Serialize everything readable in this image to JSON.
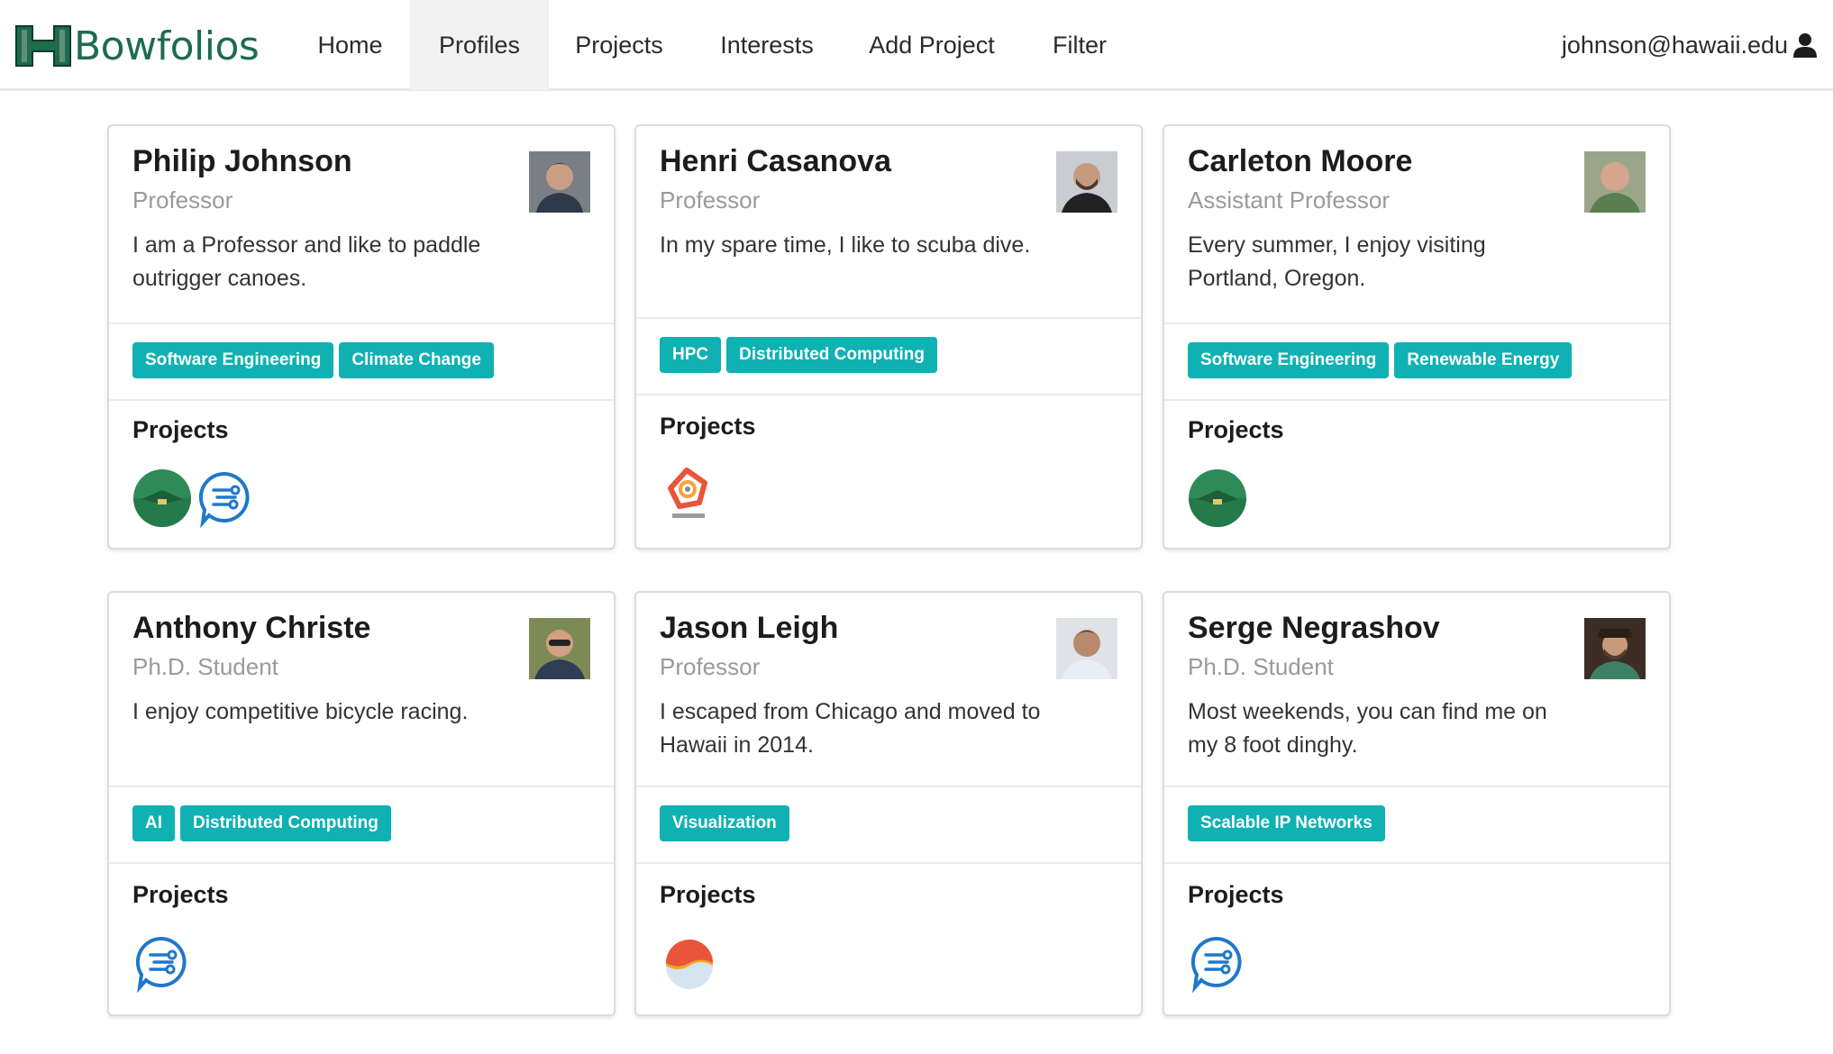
{
  "brand": {
    "name": "Bowfolios"
  },
  "nav": {
    "items": [
      "Home",
      "Profiles",
      "Projects",
      "Interests",
      "Add Project",
      "Filter"
    ],
    "active": "Profiles"
  },
  "user": {
    "email": "johnson@hawaii.edu"
  },
  "colors": {
    "tag": "#0fb1b3",
    "brand": "#1e6b4f"
  },
  "profiles": [
    {
      "name": "Philip Johnson",
      "title": "Professor",
      "bio": "I am a Professor and like to paddle outrigger canoes.",
      "interests": [
        "Software Engineering",
        "Climate Change"
      ],
      "projects_label": "Projects",
      "projects": [
        "green-hat-logo",
        "chat-circuit-logo"
      ]
    },
    {
      "name": "Henri Casanova",
      "title": "Professor",
      "bio": "In my spare time, I like to scuba dive.",
      "interests": [
        "HPC",
        "Distributed Computing"
      ],
      "projects_label": "Projects",
      "projects": [
        "wrench-logo"
      ]
    },
    {
      "name": "Carleton Moore",
      "title": "Assistant Professor",
      "bio": "Every summer, I enjoy visiting Portland, Oregon.",
      "interests": [
        "Software Engineering",
        "Renewable Energy"
      ],
      "projects_label": "Projects",
      "projects": [
        "green-hat-logo"
      ]
    },
    {
      "name": "Anthony Christe",
      "title": "Ph.D. Student",
      "bio": "I enjoy competitive bicycle racing.",
      "interests": [
        "AI",
        "Distributed Computing"
      ],
      "projects_label": "Projects",
      "projects": [
        "chat-circuit-logo"
      ]
    },
    {
      "name": "Jason Leigh",
      "title": "Professor",
      "bio": "I escaped from Chicago and moved to Hawaii in 2014.",
      "interests": [
        "Visualization"
      ],
      "projects_label": "Projects",
      "projects": [
        "wave-sun-logo"
      ]
    },
    {
      "name": "Serge Negrashov",
      "title": "Ph.D. Student",
      "bio": "Most weekends, you can find me on my 8 foot dinghy.",
      "interests": [
        "Scalable IP Networks"
      ],
      "projects_label": "Projects",
      "projects": [
        "chat-circuit-logo"
      ]
    }
  ]
}
